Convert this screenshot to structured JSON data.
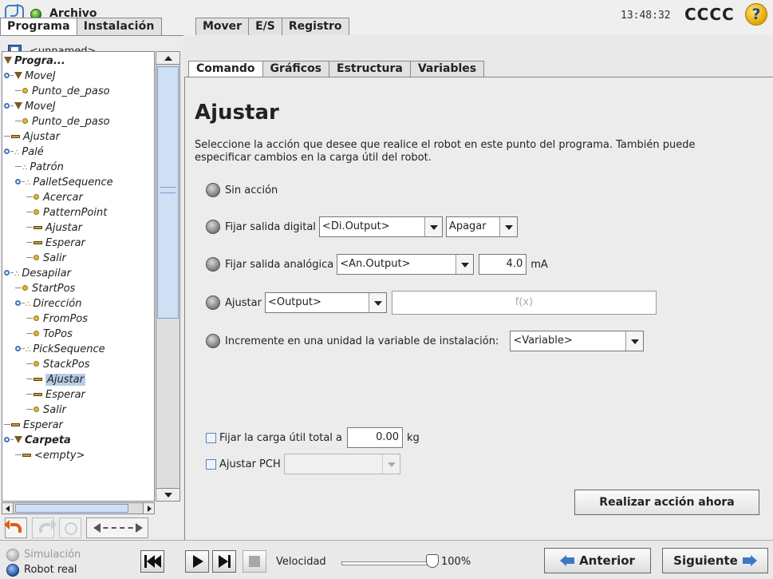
{
  "header": {
    "app_title": "Archivo",
    "clock": "13:48:32",
    "robot_name": "CCCC",
    "help_glyph": "?"
  },
  "main_tabs": [
    "Programa",
    "Instalación",
    "Mover",
    "E/S",
    "Registro"
  ],
  "program": {
    "file_name": "<unnamed>"
  },
  "sub_tabs": [
    "Comando",
    "Gráficos",
    "Estructura",
    "Variables"
  ],
  "tree": [
    {
      "label": "Progra...",
      "icon": "expand-triangle-icon"
    },
    {
      "label": "MoveJ",
      "icon": "expand-triangle-icon"
    },
    {
      "label": "Punto_de_paso",
      "icon": "waypoint-dot-icon"
    },
    {
      "label": "MoveJ",
      "icon": "expand-triangle-icon"
    },
    {
      "label": "Punto_de_paso",
      "icon": "waypoint-dot-icon"
    },
    {
      "label": "Ajustar",
      "icon": "set-bar-icon"
    },
    {
      "label": "Palé",
      "icon": "pallet-icon"
    },
    {
      "label": "Patrón",
      "icon": "pallet-icon"
    },
    {
      "label": "PalletSequence",
      "icon": "pallet-icon"
    },
    {
      "label": "Acercar",
      "icon": "waypoint-dot-icon"
    },
    {
      "label": "PatternPoint",
      "icon": "waypoint-dot-icon"
    },
    {
      "label": "Ajustar",
      "icon": "set-bar-icon"
    },
    {
      "label": "Esperar",
      "icon": "set-bar-icon"
    },
    {
      "label": "Salir",
      "icon": "waypoint-dot-icon"
    },
    {
      "label": "Desapilar",
      "icon": "pallet-icon"
    },
    {
      "label": "StartPos",
      "icon": "waypoint-dot-icon"
    },
    {
      "label": "Dirección",
      "icon": "pallet-icon"
    },
    {
      "label": "FromPos",
      "icon": "waypoint-dot-icon"
    },
    {
      "label": "ToPos",
      "icon": "waypoint-dot-icon"
    },
    {
      "label": "PickSequence",
      "icon": "pallet-icon"
    },
    {
      "label": "StackPos",
      "icon": "waypoint-dot-icon"
    },
    {
      "label": "Ajustar",
      "icon": "set-bar-icon"
    },
    {
      "label": "Esperar",
      "icon": "set-bar-icon"
    },
    {
      "label": "Salir",
      "icon": "waypoint-dot-icon"
    },
    {
      "label": "Esperar",
      "icon": "set-bar-icon"
    },
    {
      "label": "Carpeta",
      "icon": "expand-triangle-icon"
    },
    {
      "label": "<empty>",
      "icon": "set-bar-icon"
    }
  ],
  "command": {
    "title": "Ajustar",
    "description": "Seleccione la acción que desee que realice el robot en este punto del programa. También puede especificar cambios en la carga útil del robot.",
    "no_action": "Sin acción",
    "digital_label": "Fijar salida digital",
    "digital_select": "<Di.Output>",
    "digital_state": "Apagar",
    "analog_label": "Fijar salida analógica",
    "analog_select": "<An.Output>",
    "analog_value": "4.0",
    "analog_unit": "mA",
    "set_label": "Ajustar",
    "set_select": "<Output>",
    "set_expression_placeholder": "f(x)",
    "increment_label": "Incremente en una unidad la variable de instalación:",
    "increment_select": "<Variable>",
    "payload_label": "Fijar la carga útil total a",
    "payload_value": "0.00",
    "payload_unit": "kg",
    "tcp_label": "Ajustar PCH",
    "tcp_select": "",
    "perform_now": "Realizar acción ahora"
  },
  "bottom": {
    "simulation": "Simulación",
    "real_robot": "Robot real",
    "speed_label": "Velocidad",
    "speed_value": "100%",
    "speed_fraction": 1.0,
    "back": "Anterior",
    "next": "Siguiente"
  }
}
